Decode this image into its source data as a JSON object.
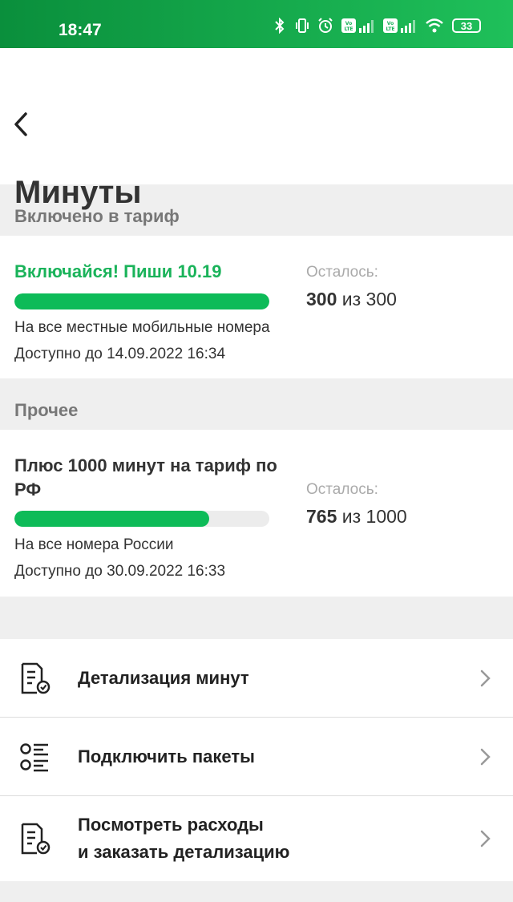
{
  "status": {
    "time": "18:47",
    "battery": "33",
    "lte1": "Vo LTE",
    "lte2": "Vo LTE"
  },
  "page": {
    "title": "Минуты"
  },
  "included": {
    "header": "Включено в тариф",
    "package": {
      "name": "Включайся! Пиши 10.19",
      "progress": 1.0,
      "scope": "На все местные мобильные номера",
      "valid": "Доступно до 14.09.2022 16:34",
      "remain_label": "Осталось:",
      "remain_value": "300",
      "remain_total": "из 300"
    }
  },
  "other": {
    "header": "Прочее",
    "package": {
      "name": "Плюс 1000 минут на тариф по РФ",
      "progress": 0.765,
      "scope": "На все номера России",
      "valid": "Доступно до 30.09.2022 16:33",
      "remain_label": "Осталось:",
      "remain_value": "765",
      "remain_total": "из 1000"
    }
  },
  "menu": [
    {
      "label": "Детализация минут",
      "icon": "document-check-icon"
    },
    {
      "label": "Подключить пакеты",
      "icon": "list-options-icon"
    },
    {
      "label_line1": "Посмотреть расходы",
      "label_line2": "и заказать детализацию",
      "icon": "document-check-icon"
    }
  ],
  "colors": {
    "accent": "#0dbb58",
    "accent_text": "#1ab35a"
  }
}
